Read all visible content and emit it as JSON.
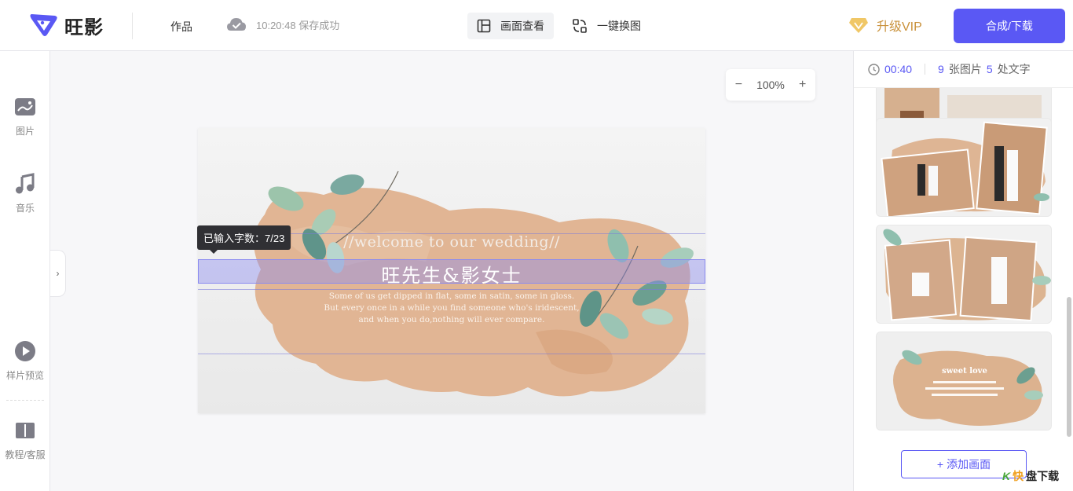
{
  "app": {
    "brand": "旺影",
    "nav_works": "作品",
    "save_status": "10:20:48 保存成功",
    "view_mode": "画面查看",
    "swap_image": "一键换图",
    "vip_label": "升级VIP",
    "export_label": "合成/下载",
    "accent_color": "#5a58f4"
  },
  "sidebar": {
    "items": [
      {
        "label": "图片",
        "icon": "image-icon"
      },
      {
        "label": "音乐",
        "icon": "music-icon"
      },
      {
        "label": "样片预览",
        "icon": "play-icon"
      },
      {
        "label": "教程/客服",
        "icon": "book-icon"
      }
    ],
    "expand_arrow": "›"
  },
  "canvas": {
    "zoom": "100%",
    "zoom_out": "−",
    "zoom_in": "+",
    "welcome": "//welcome to our wedding//",
    "title": "旺先生&影女士",
    "body_lines": [
      "Some of us get dipped in flat, some in satin, some in gloss.",
      "But every once in a while you find someone who's iridescent,",
      "and when you do,nothing will ever compare."
    ],
    "tooltip": "已输入字数：7/23"
  },
  "right_panel": {
    "duration": "00:40",
    "image_count": "9",
    "image_unit": "张图片",
    "text_count": "5",
    "text_unit": "处文字",
    "add_scene": "添加画面",
    "thumb4_title": "sweet love"
  },
  "watermark": {
    "k": "K",
    "fast": "快",
    "main": "盘下载"
  }
}
